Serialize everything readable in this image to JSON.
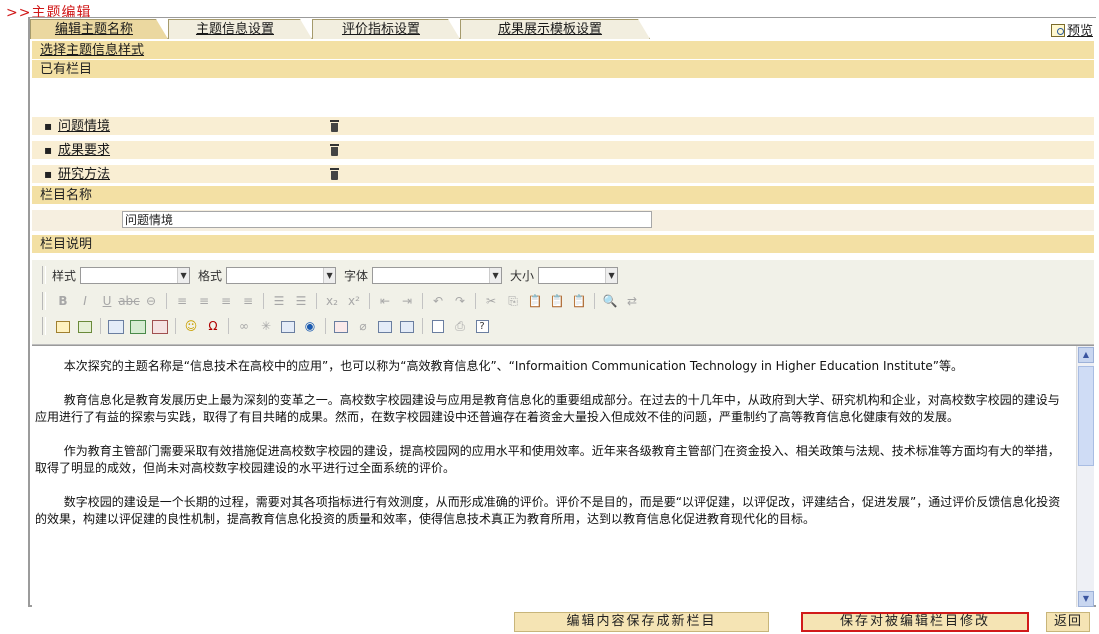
{
  "page": {
    "title": ">>主题编辑"
  },
  "tabs": [
    {
      "label": "编辑主题名称",
      "active": true
    },
    {
      "label": "主题信息设置",
      "active": false
    },
    {
      "label": "评价指标设置",
      "active": false
    },
    {
      "label": "成果展示模板设置",
      "active": false
    }
  ],
  "preview": {
    "label": "预览",
    "icon": "preview-icon"
  },
  "sections": {
    "select_style": "选择主题信息样式",
    "existing_columns": "已有栏目",
    "column_name": "栏目名称",
    "column_desc": "栏目说明"
  },
  "columns": [
    {
      "label": "问题情境",
      "icon": "trash-icon"
    },
    {
      "label": "成果要求",
      "icon": "trash-icon"
    },
    {
      "label": "研究方法",
      "icon": "trash-icon"
    }
  ],
  "column_name_input": {
    "value": "问题情境"
  },
  "editor": {
    "style_label": "样式",
    "format_label": "格式",
    "font_label": "字体",
    "size_label": "大小",
    "paragraphs": [
      "本次探究的主题名称是“信息技术在高校中的应用”，也可以称为“高效教育信息化”、“Informaition Communication Technology in Higher Education Institute”等。",
      "教育信息化是教育发展历史上最为深刻的变革之一。高校数字校园建设与应用是教育信息化的重要组成部分。在过去的十几年中，从政府到大学、研究机构和企业，对高校数字校园的建设与应用进行了有益的探索与实践，取得了有目共睹的成果。然而，在数字校园建设中还普遍存在着资金大量投入但成效不佳的问题，严重制约了高等教育信息化健康有效的发展。",
      "作为教育主管部门需要采取有效措施促进高校数字校园的建设，提高校园网的应用水平和使用效率。近年来各级教育主管部门在资金投入、相关政策与法规、技术标准等方面均有大的举措，取得了明显的成效，但尚未对高校数字校园建设的水平进行过全面系统的评价。",
      "数字校园的建设是一个长期的过程，需要对其各项指标进行有效测度，从而形成准确的评价。评价不是目的，而是要“以评促建，以评促改，评建结合，促进发展”，通过评价反馈信息化投资的效果，构建以评促建的良性机制，提高教育信息化投资的质量和效率，使得信息技术真正为教育所用，达到以教育信息化促进教育现代化的目标。"
    ]
  },
  "buttons": {
    "save_new": "编辑内容保存成新栏目",
    "save_edit": "保存对被编辑栏目修改",
    "back": "返回"
  }
}
